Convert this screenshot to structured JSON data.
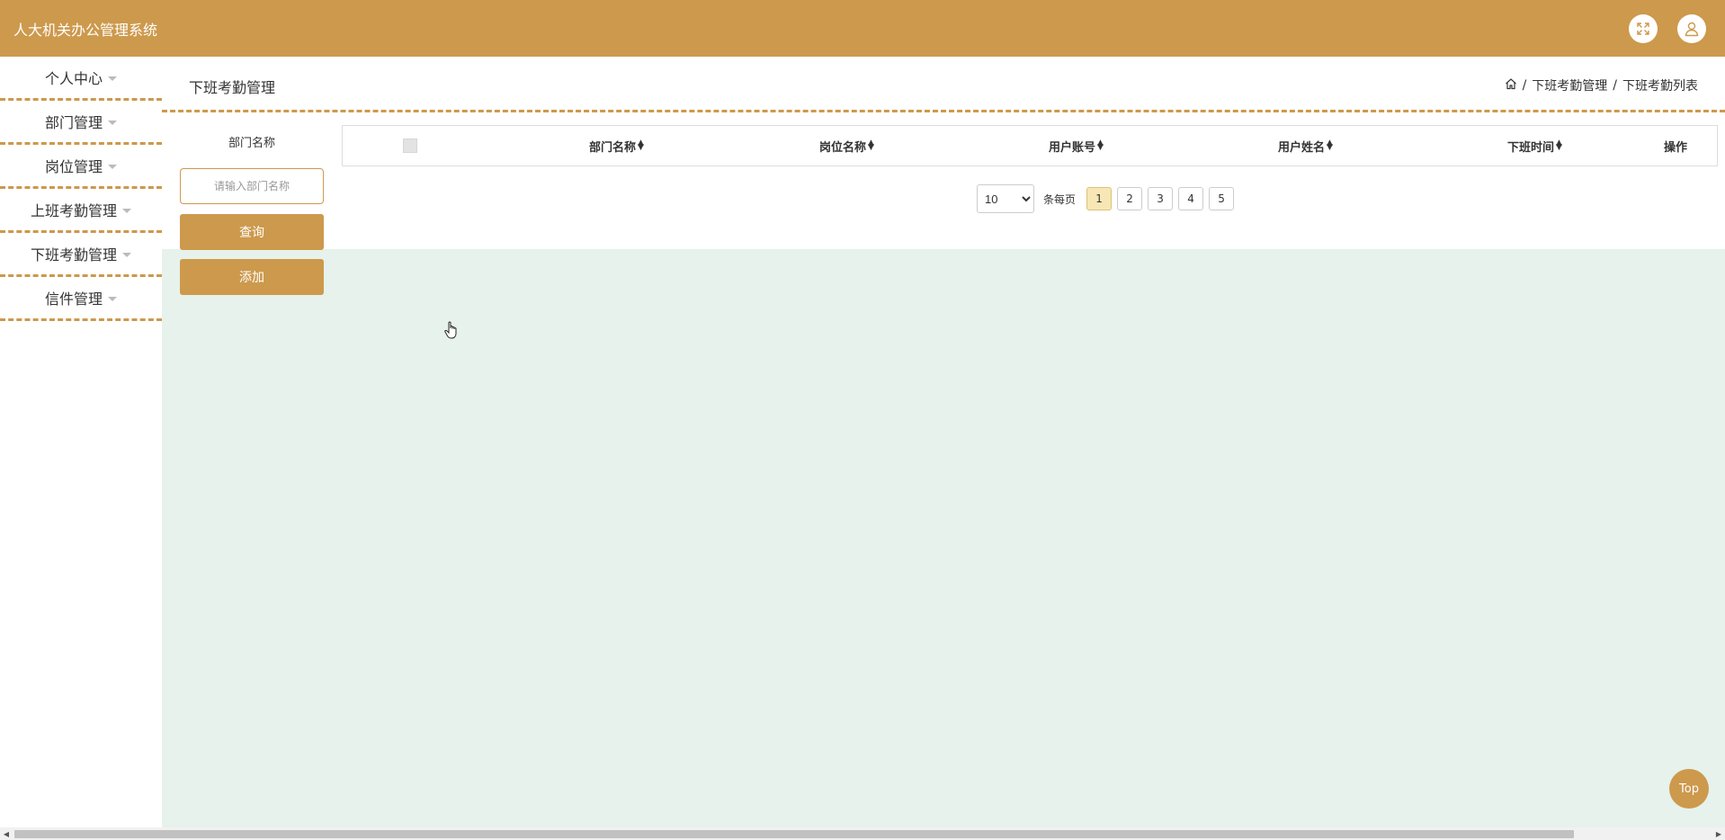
{
  "header": {
    "app_title": "人大机关办公管理系统",
    "icons": {
      "fullscreen": "fullscreen-icon",
      "user": "user-icon"
    }
  },
  "sidebar": {
    "items": [
      {
        "label": "个人中心"
      },
      {
        "label": "部门管理"
      },
      {
        "label": "岗位管理"
      },
      {
        "label": "上班考勤管理"
      },
      {
        "label": "下班考勤管理"
      },
      {
        "label": "信件管理"
      }
    ]
  },
  "page": {
    "title": "下班考勤管理",
    "breadcrumb": {
      "separator": "/",
      "items": [
        "下班考勤管理",
        "下班考勤列表"
      ]
    }
  },
  "search": {
    "label": "部门名称",
    "placeholder": "请输入部门名称",
    "value": "",
    "query_label": "查询",
    "add_label": "添加"
  },
  "table": {
    "columns": [
      "部门名称",
      "岗位名称",
      "用户账号",
      "用户姓名",
      "下班时间",
      "操作"
    ],
    "rows": []
  },
  "pagination": {
    "page_size": "10",
    "page_size_options": [
      "10"
    ],
    "per_page_label": "条每页",
    "pages": [
      "1",
      "2",
      "3",
      "4",
      "5"
    ],
    "current": "1"
  },
  "top_button_label": "Top",
  "colors": {
    "accent": "#cd994c",
    "content_bg": "#e6f2eb",
    "active_page_bg": "#f7e7b4"
  }
}
